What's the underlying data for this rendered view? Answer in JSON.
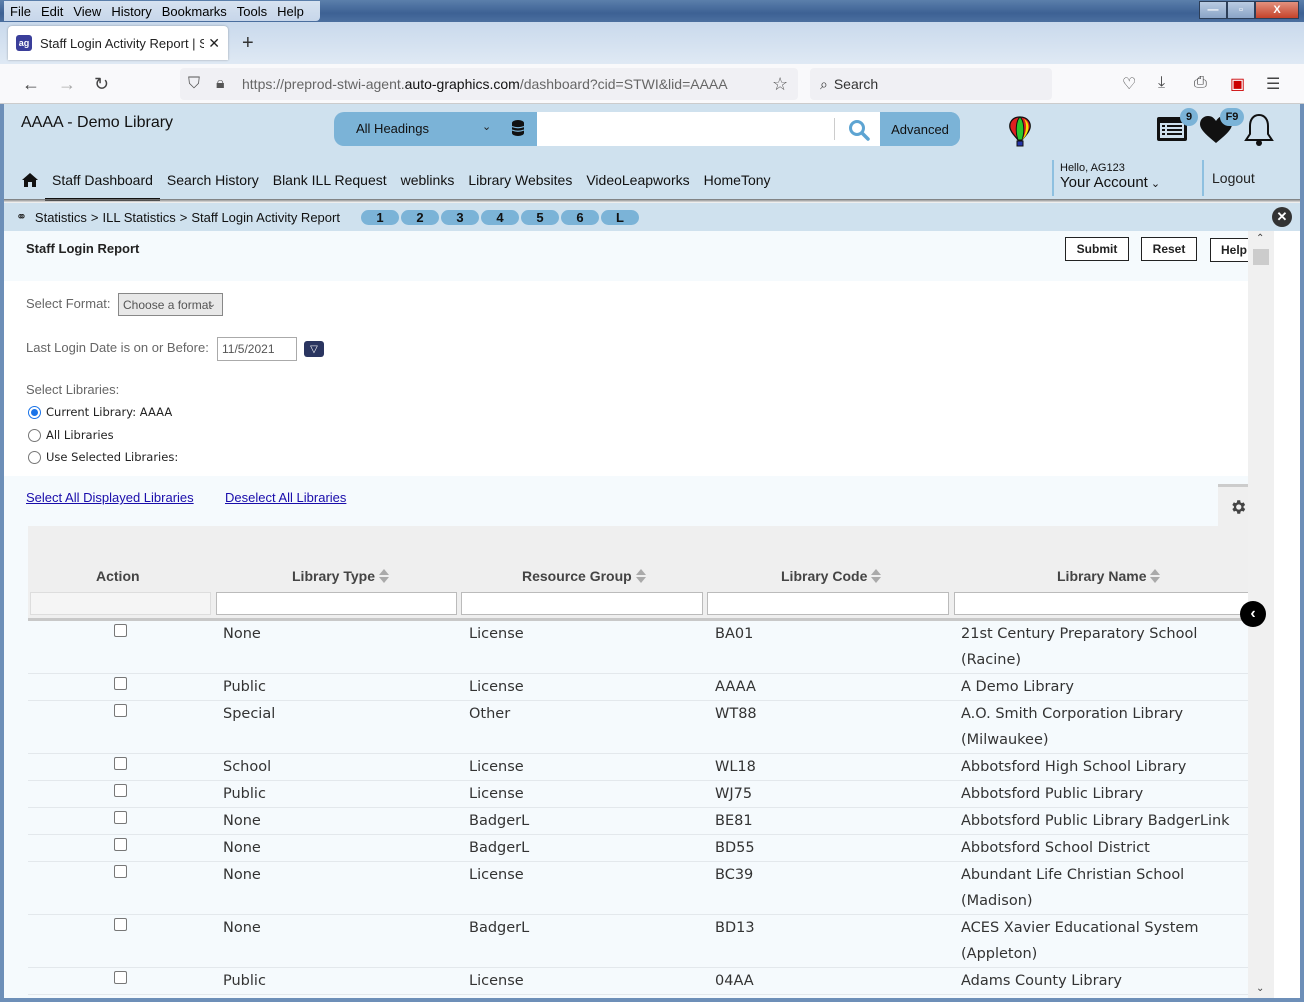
{
  "browser": {
    "menu": [
      "File",
      "Edit",
      "View",
      "History",
      "Bookmarks",
      "Tools",
      "Help"
    ],
    "tab_title": "Staff Login Activity Report | STWI",
    "url_prefix": "https://preprod-stwi-agent.",
    "url_domain": "auto-graphics.com",
    "url_suffix": "/dashboard?cid=STWI&lid=AAAA",
    "search_placeholder": "Search"
  },
  "header": {
    "library_title": "AAAA - Demo Library",
    "search_scope": "All Headings",
    "search_value": "",
    "advanced_label": "Advanced",
    "list_badge": "9",
    "favorites_badge": "F9",
    "hello": "Hello, AG123",
    "account_label": "Your Account",
    "logout_label": "Logout",
    "nav": [
      "Staff Dashboard",
      "Search History",
      "Blank ILL Request",
      "weblinks",
      "Library Websites",
      "VideoLeapworks",
      "HomeTony"
    ],
    "active_nav": "Staff Dashboard"
  },
  "breadcrumb": {
    "items": [
      "Statistics",
      "ILL Statistics",
      "Staff Login Activity Report"
    ],
    "separator": ">",
    "steps": [
      "1",
      "2",
      "3",
      "4",
      "5",
      "6",
      "L"
    ]
  },
  "report": {
    "title": "Staff Login Report",
    "buttons": {
      "submit": "Submit",
      "reset": "Reset",
      "help": "Help"
    },
    "format_label": "Select Format:",
    "format_value": "Choose a format",
    "date_label": "Last Login Date is on or Before:",
    "date_value": "11/5/2021",
    "libraries_label": "Select Libraries:",
    "library_options": [
      {
        "label": "Current Library: AAAA",
        "checked": true
      },
      {
        "label": "All Libraries",
        "checked": false
      },
      {
        "label": "Use Selected Libraries:",
        "checked": false
      }
    ],
    "select_all_link": "Select All Displayed Libraries",
    "deselect_all_link": "Deselect All Libraries"
  },
  "table": {
    "columns": [
      "Action",
      "Library Type",
      "Resource Group",
      "Library Code",
      "Library Name"
    ],
    "rows": [
      {
        "type": "None",
        "group": "License",
        "code": "BA01",
        "name": "21st Century Preparatory School (Racine)",
        "checked": false
      },
      {
        "type": "Public",
        "group": "License",
        "code": "AAAA",
        "name": "A Demo Library",
        "checked": false
      },
      {
        "type": "Special",
        "group": "Other",
        "code": "WT88",
        "name": "A.O. Smith Corporation Library (Milwaukee)",
        "checked": false
      },
      {
        "type": "School",
        "group": "License",
        "code": "WL18",
        "name": "Abbotsford High School Library",
        "checked": false
      },
      {
        "type": "Public",
        "group": "License",
        "code": "WJ75",
        "name": "Abbotsford Public Library",
        "checked": false
      },
      {
        "type": "None",
        "group": "BadgerL",
        "code": "BE81",
        "name": "Abbotsford Public Library BadgerLink",
        "checked": false
      },
      {
        "type": "None",
        "group": "BadgerL",
        "code": "BD55",
        "name": "Abbotsford School District",
        "checked": false
      },
      {
        "type": "None",
        "group": "License",
        "code": "BC39",
        "name": "Abundant Life Christian School (Madison)",
        "checked": false
      },
      {
        "type": "None",
        "group": "BadgerL",
        "code": "BD13",
        "name": "ACES Xavier Educational System (Appleton)",
        "checked": false
      },
      {
        "type": "Public",
        "group": "License",
        "code": "04AA",
        "name": "Adams County Library",
        "checked": false
      }
    ]
  }
}
